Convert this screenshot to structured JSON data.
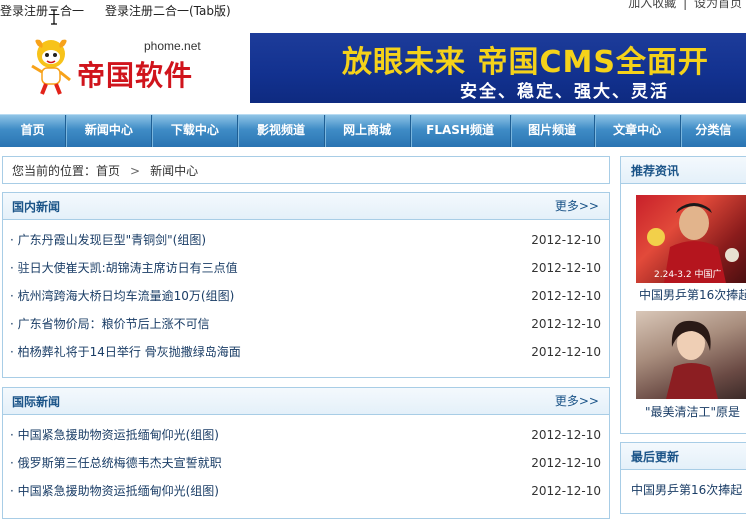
{
  "topbar": {
    "login_one": "登录注册二合一",
    "login_tab": "登录注册二合一(Tab版)",
    "favorite": "加入收藏",
    "separator": "|",
    "homepage": "设为首页"
  },
  "header": {
    "site_url": "phome.net",
    "site_name": "帝国软件",
    "banner_title": "放眼未来 帝国CMS全面开",
    "banner_slogan": "安全、稳定、强大、灵活"
  },
  "nav": {
    "items": [
      "首页",
      "新闻中心",
      "下载中心",
      "影视频道",
      "网上商城",
      "FLASH频道",
      "图片频道",
      "文章中心",
      "分类信"
    ]
  },
  "breadcrumb": {
    "prefix": "您当前的位置：",
    "home": "首页",
    "arrow": ">",
    "current": "新闻中心"
  },
  "domestic": {
    "title": "国内新闻",
    "more": "更多>>",
    "items": [
      {
        "title": "· 广东丹霞山发现巨型\"青铜剑\"(组图)",
        "date": "2012-12-10"
      },
      {
        "title": "· 驻日大使崔天凯:胡锦涛主席访日有三点值",
        "date": "2012-12-10"
      },
      {
        "title": "· 杭州湾跨海大桥日均车流量逾10万(组图)",
        "date": "2012-12-10"
      },
      {
        "title": "· 广东省物价局：粮价节后上涨不可信",
        "date": "2012-12-10"
      },
      {
        "title": "· 柏杨葬礼将于14日举行 骨灰抛撒绿岛海面",
        "date": "2012-12-10"
      }
    ]
  },
  "international": {
    "title": "国际新闻",
    "more": "更多>>",
    "items": [
      {
        "title": "· 中国紧急援助物资运抵缅甸仰光(组图)",
        "date": "2012-12-10"
      },
      {
        "title": "· 俄罗斯第三任总统梅德韦杰夫宣誓就职",
        "date": "2012-12-10"
      },
      {
        "title": "· 中国紧急援助物资运抵缅甸仰光(组图)",
        "date": "2012-12-10"
      }
    ]
  },
  "recommend": {
    "title": "推荐资讯",
    "pic1_caption": "中国男乒第16次捧起",
    "pic1_overlay": "2.24-3.2  中国广",
    "pic2_caption": "\"最美清洁工\"原是"
  },
  "latest": {
    "title": "最后更新",
    "items": [
      "中国男乒第16次捧起"
    ]
  }
}
